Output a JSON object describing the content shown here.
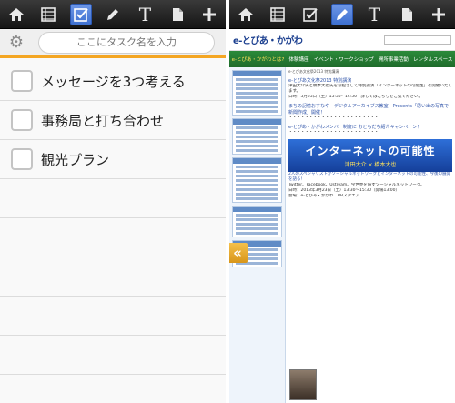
{
  "left_app": {
    "toolbar": {
      "icons": [
        "home-icon",
        "list-icon",
        "checkbox-icon",
        "pencil-icon",
        "text-icon",
        "document-icon",
        "plus-icon"
      ],
      "active": "checkbox-icon",
      "text_glyph": "T"
    },
    "input_bar": {
      "gear_glyph": "⚙",
      "placeholder": "ここにタスク名を入力"
    },
    "tasks": [
      {
        "label": "メッセージを3つ考える",
        "checked": false
      },
      {
        "label": "事務局と打ち合わせ",
        "checked": false
      },
      {
        "label": "観光プラン",
        "checked": false
      }
    ],
    "colors": {
      "accent": "#f4a623"
    }
  },
  "right_app": {
    "toolbar": {
      "icons": [
        "home-icon",
        "list-icon",
        "checkbox-icon",
        "pencil-icon",
        "text-icon",
        "document-icon",
        "plus-icon"
      ],
      "active": "pencil-icon",
      "text_glyph": "T"
    },
    "web": {
      "logo": "e-とぴあ・かがわ",
      "nav": [
        "e-とぴあ・かがわとは?",
        "体験講座",
        "イベント・ワークショップ",
        "開所事業活動",
        "レンタルスペース"
      ],
      "breadcrumb": "e-とぴあ文化祭2013 特別講演",
      "headline": "e-とぴあ文化祭2013 特別講演",
      "intro_lines": [
        "津田大介氏と橋本大也氏をお招きして特別講演「インターネットの可能性」を開催いたします。",
        "日時：3月23日（土）13:30〜15:30　詳しくはこちらをご覧ください。"
      ],
      "section2": "まちの記憶おすなや　デジタルアーカイブス教室　Presents「思い出の写真で新聞作成」開催！",
      "section3": "e-とぴあ・かがわメンバー制度に おともだち紹介キャンペーン！",
      "banner_title": "インターネットの可能性",
      "banner_sub": "津田大介 × 橋本大也",
      "body_lines": [
        "2人のスペシャリストがソーシャルネットワークとインターネットの可能性、今後の展開を語る！",
        "Twitter、Facebook、Ustream、今世界を賑すソーシャルネットワーク。",
        "日時：2013年3月23日（土）13:30〜15:30（開場13:00）",
        "会場：e-とぴあ・かがわ　BBスクエア"
      ],
      "arrow_glyph": "«"
    }
  }
}
